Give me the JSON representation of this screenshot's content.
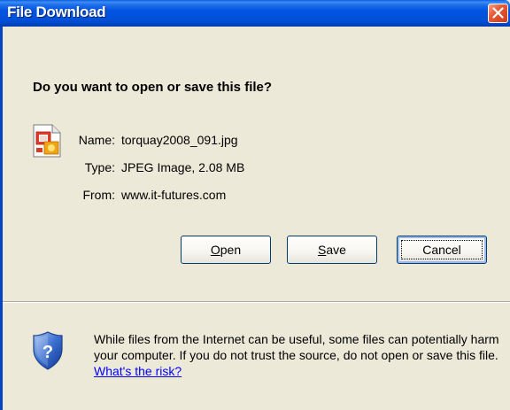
{
  "window": {
    "title": "File Download"
  },
  "dialog": {
    "question": "Do you want to open or save this file?",
    "file": {
      "name_label": "Name:",
      "name_value": "torquay2008_091.jpg",
      "type_label": "Type:",
      "type_value": "JPEG Image, 2.08 MB",
      "from_label": "From:",
      "from_value": "www.it-futures.com"
    },
    "buttons": {
      "open": {
        "mnemonic": "O",
        "rest": "pen"
      },
      "save": {
        "mnemonic": "S",
        "rest": "ave"
      },
      "cancel": "Cancel"
    },
    "warning": {
      "text": "While files from the Internet can be useful, some files can potentially harm your computer. If you do not trust the source, do not open or save this file. ",
      "link": "What's the risk?"
    }
  },
  "icons": {
    "file": "jpeg-file-icon",
    "warning": "security-shield-icon",
    "close": "close-icon"
  },
  "colors": {
    "titlebar": "#0054e3",
    "close": "#e65a37",
    "dialog_bg": "#ece9d8",
    "link": "#0000ff"
  }
}
